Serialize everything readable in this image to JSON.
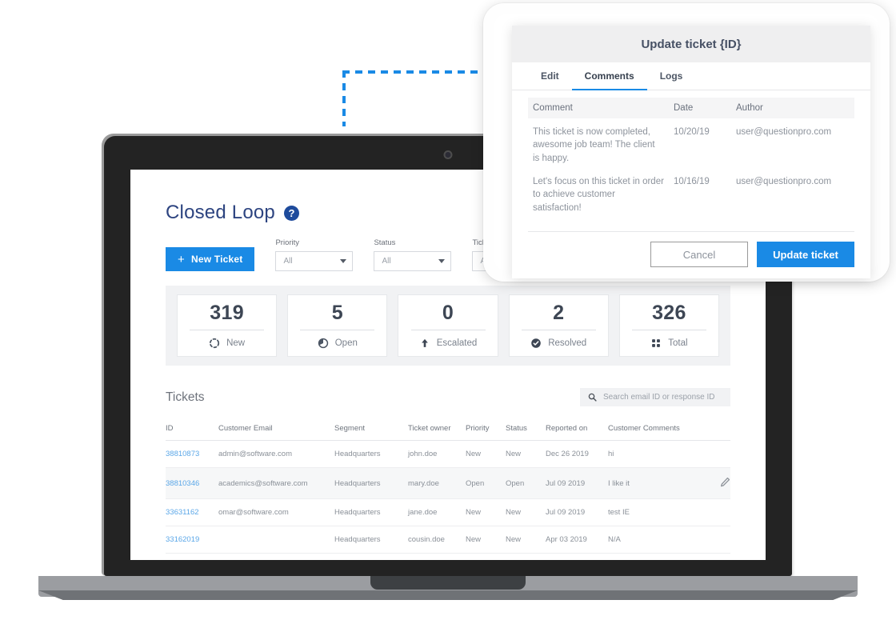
{
  "dashboard": {
    "title": "Closed Loop",
    "help_icon": "question-mark-icon",
    "new_ticket_label": "New Ticket",
    "plus_glyph": "+",
    "filters": [
      {
        "label": "Priority",
        "value": "All"
      },
      {
        "label": "Status",
        "value": "All"
      },
      {
        "label": "Ticket owner",
        "value": "All"
      }
    ],
    "stats": [
      {
        "value": "319",
        "label": "New",
        "icon": "dashed-circle-icon"
      },
      {
        "value": "5",
        "label": "Open",
        "icon": "pie-chart-icon"
      },
      {
        "value": "0",
        "label": "Escalated",
        "icon": "up-arrow-icon"
      },
      {
        "value": "2",
        "label": "Resolved",
        "icon": "check-circle-icon"
      },
      {
        "value": "326",
        "label": "Total",
        "icon": "grid-dots-icon"
      }
    ],
    "tickets": {
      "section_title": "Tickets",
      "search_placeholder": "Search email ID or response ID",
      "search_icon": "search-icon",
      "columns": [
        "ID",
        "Customer Email",
        "Segment",
        "Ticket owner",
        "Priority",
        "Status",
        "Reported on",
        "Customer Comments"
      ],
      "rows": [
        {
          "id": "38810873",
          "email": "admin@software.com",
          "segment": "Headquarters",
          "owner": "john.doe",
          "priority": "New",
          "status": "New",
          "reported": "Dec 26 2019",
          "comment": "hi",
          "highlighted": false
        },
        {
          "id": "38810346",
          "email": "academics@software.com",
          "segment": "Headquarters",
          "owner": "mary.doe",
          "priority": "Open",
          "status": "Open",
          "reported": "Jul 09 2019",
          "comment": "I like it",
          "highlighted": true
        },
        {
          "id": "33631162",
          "email": "omar@software.com",
          "segment": "Headquarters",
          "owner": "jane.doe",
          "priority": "New",
          "status": "New",
          "reported": "Jul 09 2019",
          "comment": "test IE",
          "highlighted": false
        },
        {
          "id": "33162019",
          "email": "",
          "segment": "Headquarters",
          "owner": "cousin.doe",
          "priority": "New",
          "status": "New",
          "reported": "Apr 03 2019",
          "comment": "N/A",
          "highlighted": false
        }
      ],
      "edit_icon": "pencil-icon"
    }
  },
  "modal": {
    "title": "Update ticket {ID}",
    "tabs": [
      {
        "label": "Edit",
        "active": false
      },
      {
        "label": "Comments",
        "active": true
      },
      {
        "label": "Logs",
        "active": false
      }
    ],
    "columns": [
      "Comment",
      "Date",
      "Author"
    ],
    "comments": [
      {
        "text": "This ticket is now completed, awesome job team! The client is happy.",
        "date": "10/20/19",
        "author": "user@questionpro.com"
      },
      {
        "text": "Let's focus on this ticket in order to achieve customer satisfaction!",
        "date": "10/16/19",
        "author": "user@questionpro.com"
      }
    ],
    "cancel_label": "Cancel",
    "update_label": "Update ticket"
  },
  "colors": {
    "accent_blue": "#1a8ae5",
    "title_navy": "#2d4480",
    "link_blue": "#5ba7e8",
    "guide_blue": "#1a8ae5",
    "stat_value": "#3d4654",
    "muted_text": "#8a9098"
  }
}
